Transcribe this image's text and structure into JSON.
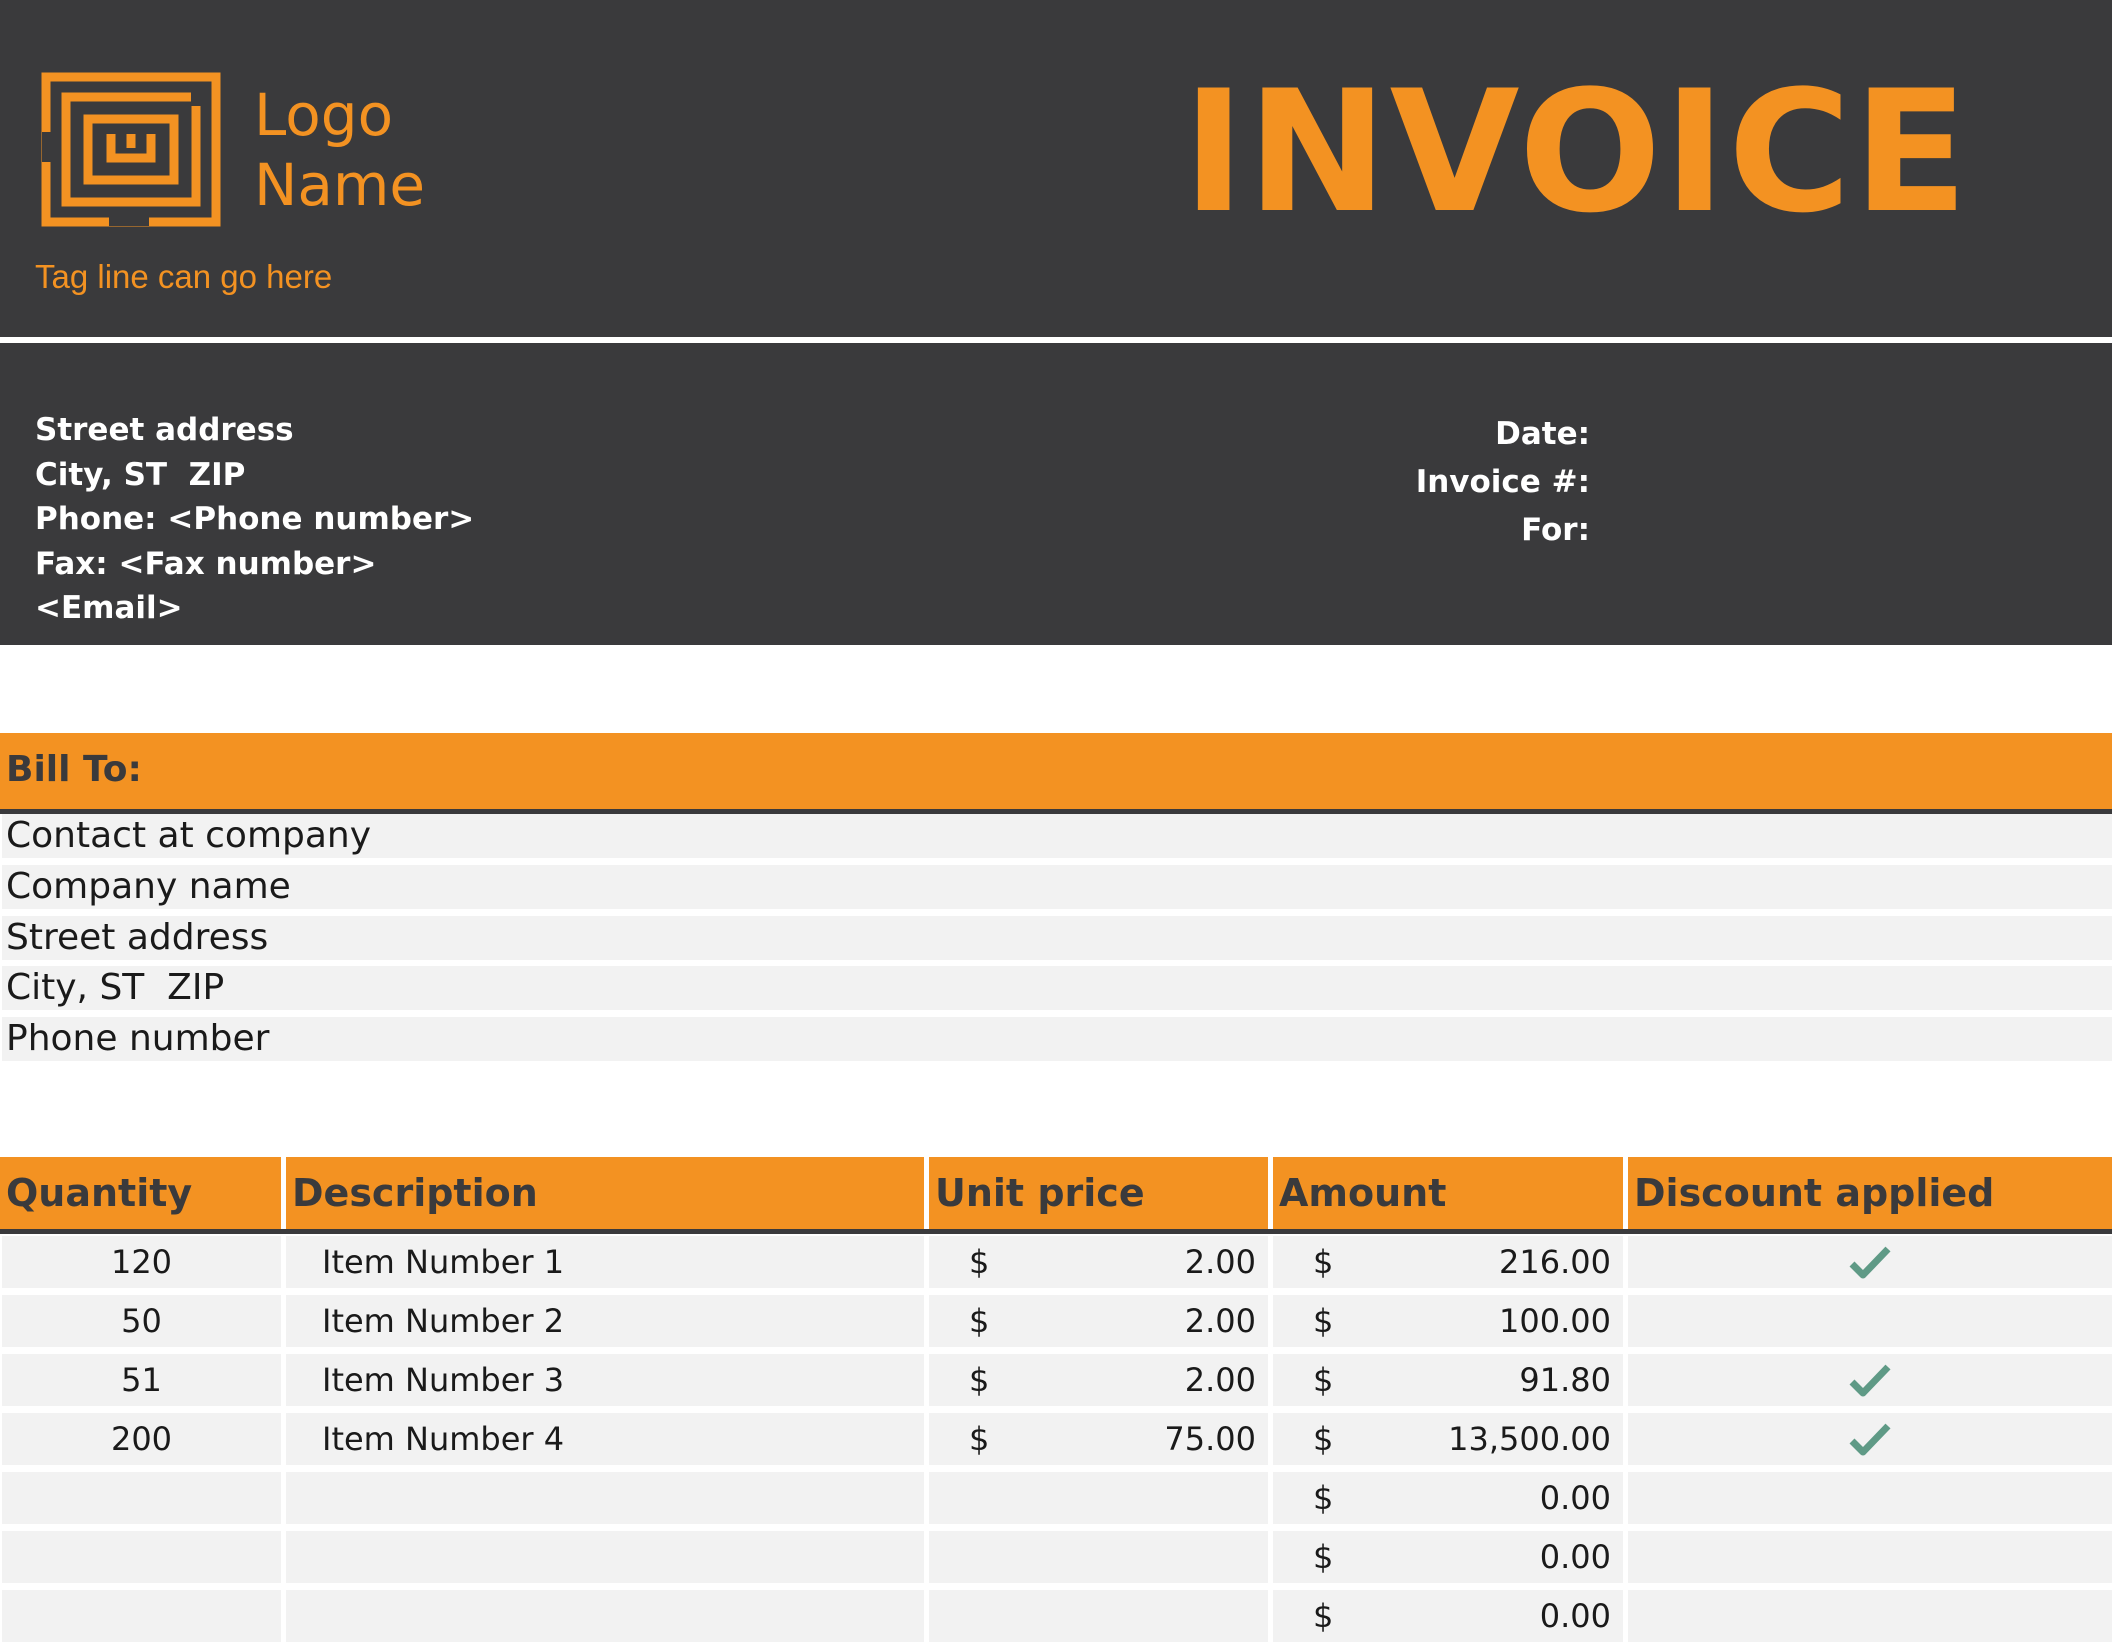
{
  "brand": {
    "logo_line1": "Logo",
    "logo_line2": "Name",
    "tagline": "Tag line can go here",
    "logo_icon": "maze-logo-icon",
    "accent_color": "#f39222",
    "dark_color": "#3a3a3c"
  },
  "title": "INVOICE",
  "sender": {
    "street": "Street address",
    "city": "City, ST  ZIP",
    "phone": "Phone: <Phone number>",
    "fax": "Fax: <Fax number>",
    "email": "<Email>"
  },
  "meta": {
    "date_label": "Date:",
    "invoice_label": "Invoice #:",
    "for_label": "For:"
  },
  "bill_to": {
    "heading": "Bill To:",
    "lines": [
      "Contact at company",
      "Company name",
      "Street address",
      "City, ST  ZIP",
      "Phone number"
    ]
  },
  "table": {
    "headers": [
      "Quantity",
      "Description",
      "Unit price",
      "Amount",
      "Discount applied"
    ],
    "currency_symbol": "$",
    "check_icon": "checkmark-icon",
    "rows": [
      {
        "quantity": "120",
        "description": "Item Number 1",
        "unit_price": "2.00",
        "amount": "216.00",
        "discount": true
      },
      {
        "quantity": "50",
        "description": "Item Number 2",
        "unit_price": "2.00",
        "amount": "100.00",
        "discount": false
      },
      {
        "quantity": "51",
        "description": "Item Number 3",
        "unit_price": "2.00",
        "amount": "91.80",
        "discount": true
      },
      {
        "quantity": "200",
        "description": "Item Number 4",
        "unit_price": "75.00",
        "amount": "13,500.00",
        "discount": true
      },
      {
        "quantity": "",
        "description": "",
        "unit_price": "",
        "amount": "0.00",
        "discount": false
      },
      {
        "quantity": "",
        "description": "",
        "unit_price": "",
        "amount": "0.00",
        "discount": false
      },
      {
        "quantity": "",
        "description": "",
        "unit_price": "",
        "amount": "0.00",
        "discount": false
      }
    ]
  }
}
